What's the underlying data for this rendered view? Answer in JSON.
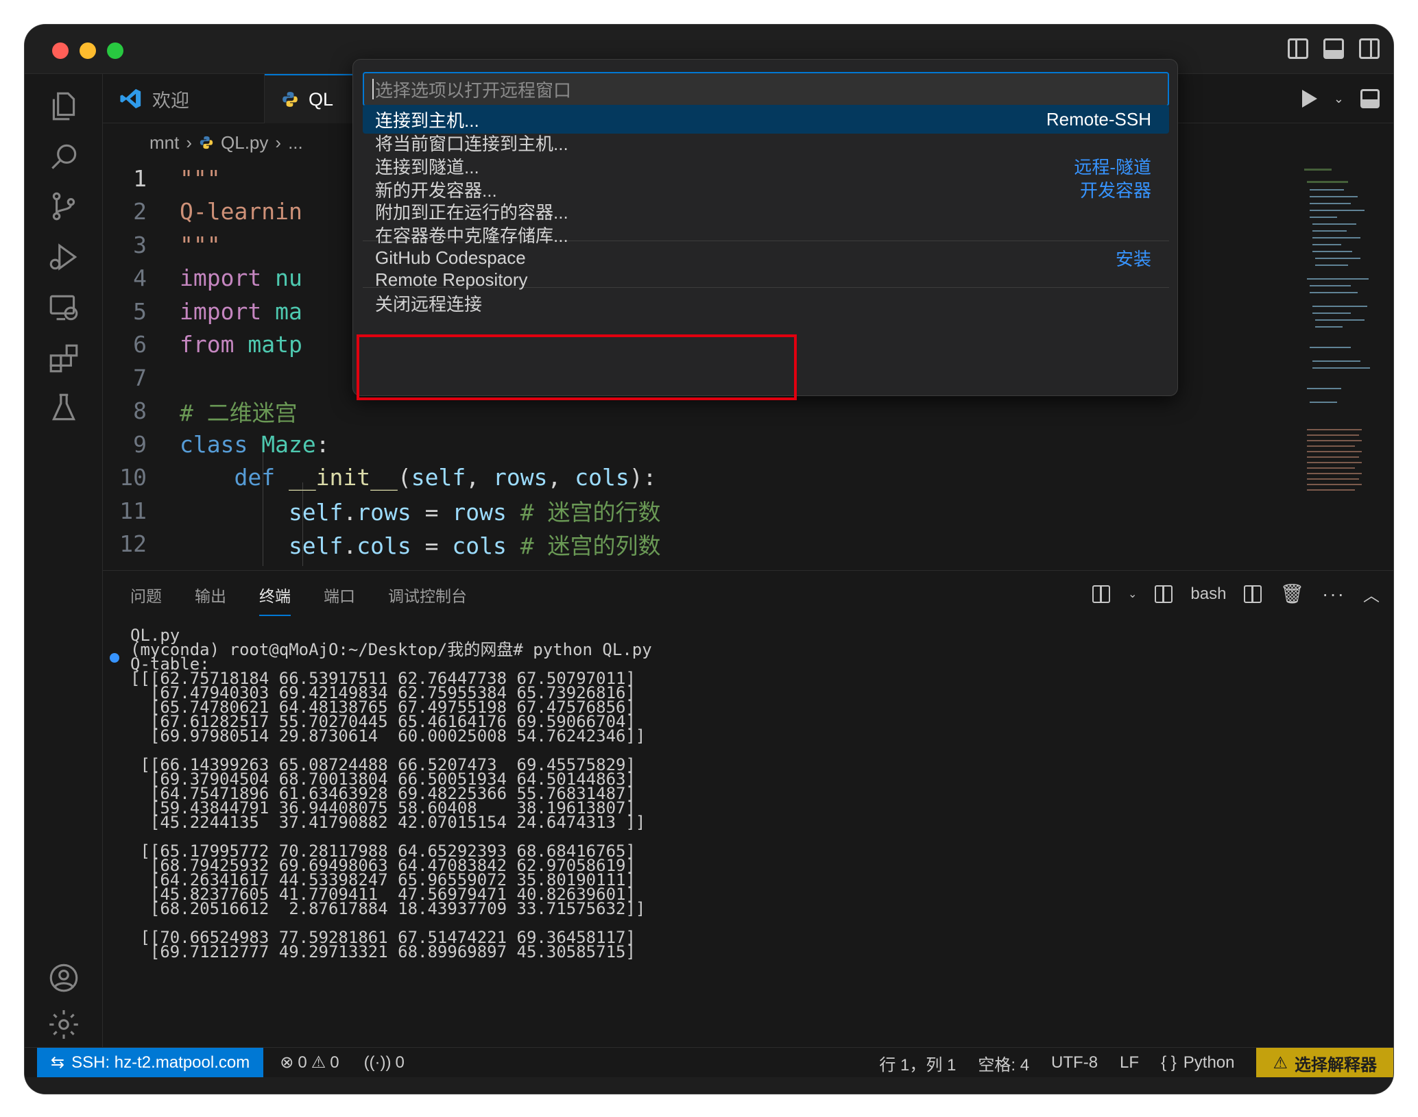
{
  "window": {
    "layout_icons": [
      "toggle-primary-sidebar-icon",
      "toggle-panel-icon",
      "toggle-secondary-sidebar-icon"
    ]
  },
  "tabs": [
    {
      "label": "欢迎",
      "icon": "vscode-logo-icon"
    },
    {
      "label": "QL",
      "icon": "python-file-icon"
    }
  ],
  "breadcrumb": {
    "root": "mnt",
    "file": "QL.py",
    "more": "..."
  },
  "editor": {
    "lines": [
      {
        "n": "1",
        "tokens": [
          {
            "t": "\"\"\"",
            "c": "str"
          }
        ]
      },
      {
        "n": "2",
        "tokens": [
          {
            "t": "Q-learnin",
            "c": "str"
          }
        ]
      },
      {
        "n": "3",
        "tokens": [
          {
            "t": "\"\"\"",
            "c": "str"
          }
        ]
      },
      {
        "n": "4",
        "tokens": [
          {
            "t": "import",
            "c": "kw2"
          },
          {
            "t": " nu",
            "c": "cls"
          }
        ]
      },
      {
        "n": "5",
        "tokens": [
          {
            "t": "import",
            "c": "kw2"
          },
          {
            "t": " ma",
            "c": "cls"
          }
        ]
      },
      {
        "n": "6",
        "tokens": [
          {
            "t": "from",
            "c": "kw2"
          },
          {
            "t": " matp",
            "c": "cls"
          }
        ]
      },
      {
        "n": "7",
        "tokens": []
      },
      {
        "n": "8",
        "tokens": [
          {
            "t": "# 二维迷宫",
            "c": "com"
          }
        ]
      },
      {
        "n": "9",
        "tokens": [
          {
            "t": "class",
            "c": "kw"
          },
          {
            "t": " Maze",
            "c": "cls"
          },
          {
            "t": ":",
            "c": "plain"
          }
        ]
      },
      {
        "n": "10",
        "tokens": [
          {
            "t": "    def",
            "c": "kw"
          },
          {
            "t": " __init__",
            "c": "fn"
          },
          {
            "t": "(",
            "c": "plain"
          },
          {
            "t": "self",
            "c": "var"
          },
          {
            "t": ", ",
            "c": "plain"
          },
          {
            "t": "rows",
            "c": "var"
          },
          {
            "t": ", ",
            "c": "plain"
          },
          {
            "t": "cols",
            "c": "var"
          },
          {
            "t": "):",
            "c": "plain"
          }
        ]
      },
      {
        "n": "11",
        "tokens": [
          {
            "t": "        self",
            "c": "var"
          },
          {
            "t": ".",
            "c": "plain"
          },
          {
            "t": "rows",
            "c": "var"
          },
          {
            "t": " = ",
            "c": "plain"
          },
          {
            "t": "rows",
            "c": "var"
          },
          {
            "t": " # 迷宫的行数",
            "c": "com"
          }
        ]
      },
      {
        "n": "12",
        "tokens": [
          {
            "t": "        self",
            "c": "var"
          },
          {
            "t": ".",
            "c": "plain"
          },
          {
            "t": "cols",
            "c": "var"
          },
          {
            "t": " = ",
            "c": "plain"
          },
          {
            "t": "cols",
            "c": "var"
          },
          {
            "t": " # 迷宫的列数",
            "c": "com"
          }
        ]
      }
    ]
  },
  "quickpick": {
    "placeholder": "选择选项以打开远程窗口",
    "items": [
      {
        "label": "连接到主机...",
        "tag": "Remote-SSH",
        "selected": true
      },
      {
        "label": "将当前窗口连接到主机...",
        "tag": ""
      },
      {
        "label": "连接到隧道...",
        "tag": "远程-隧道"
      },
      {
        "label": "新的开发容器...",
        "tag": "开发容器"
      },
      {
        "label": "附加到正在运行的容器...",
        "tag": ""
      },
      {
        "label": "在容器卷中克隆存储库...",
        "tag": ""
      },
      {
        "label": "GitHub Codespace",
        "tag": "安装"
      },
      {
        "label": "Remote Repository",
        "tag": ""
      },
      {
        "label": "关闭远程连接",
        "tag": ""
      }
    ]
  },
  "panel": {
    "tabs": [
      "问题",
      "输出",
      "终端",
      "端口",
      "调试控制台"
    ],
    "active_tab": "终端",
    "shell": "bash"
  },
  "terminal": {
    "lines": [
      "QL.py",
      "(myconda) root@qMoAjO:~/Desktop/我的网盘# python QL.py",
      "Q-table:",
      "[[[62.75718184 66.53917511 62.76447738 67.50797011]",
      "  [67.47940303 69.42149834 62.75955384 65.73926816]",
      "  [65.74780621 64.48138765 67.49755198 67.47576856]",
      "  [67.61282517 55.70270445 65.46164176 69.59066704]",
      "  [69.97980514 29.8730614  60.00025008 54.76242346]]",
      "",
      " [[66.14399263 65.08724488 66.5207473  69.45575829]",
      "  [69.37904504 68.70013804 66.50051934 64.50144863]",
      "  [64.75471896 61.63463928 69.48225366 55.76831487]",
      "  [59.43844791 36.94408075 58.60408    38.19613807]",
      "  [45.2244135  37.41790882 42.07015154 24.6474313 ]]",
      "",
      " [[65.17995772 70.28117988 64.65292393 68.68416765]",
      "  [68.79425932 69.69498063 64.47083842 62.97058619]",
      "  [64.26341617 44.53398247 65.96559072 35.80190111]",
      "  [45.82377605 41.7709411  47.56979471 40.82639601]",
      "  [68.20516612  2.87617884 18.43937709 33.71575632]]",
      "",
      " [[70.66524983 77.59281861 67.51474221 69.36458117]",
      "  [69.71212777 49.29713321 68.89969897 45.30585715]"
    ]
  },
  "statusbar": {
    "remote": "SSH: hz-t2.matpool.com",
    "errors": "0",
    "warnings": "0",
    "ports": "0",
    "position": "行 1，列 1",
    "spaces": "空格: 4",
    "encoding": "UTF-8",
    "eol": "LF",
    "language": "Python",
    "interpreter": "选择解释器"
  }
}
